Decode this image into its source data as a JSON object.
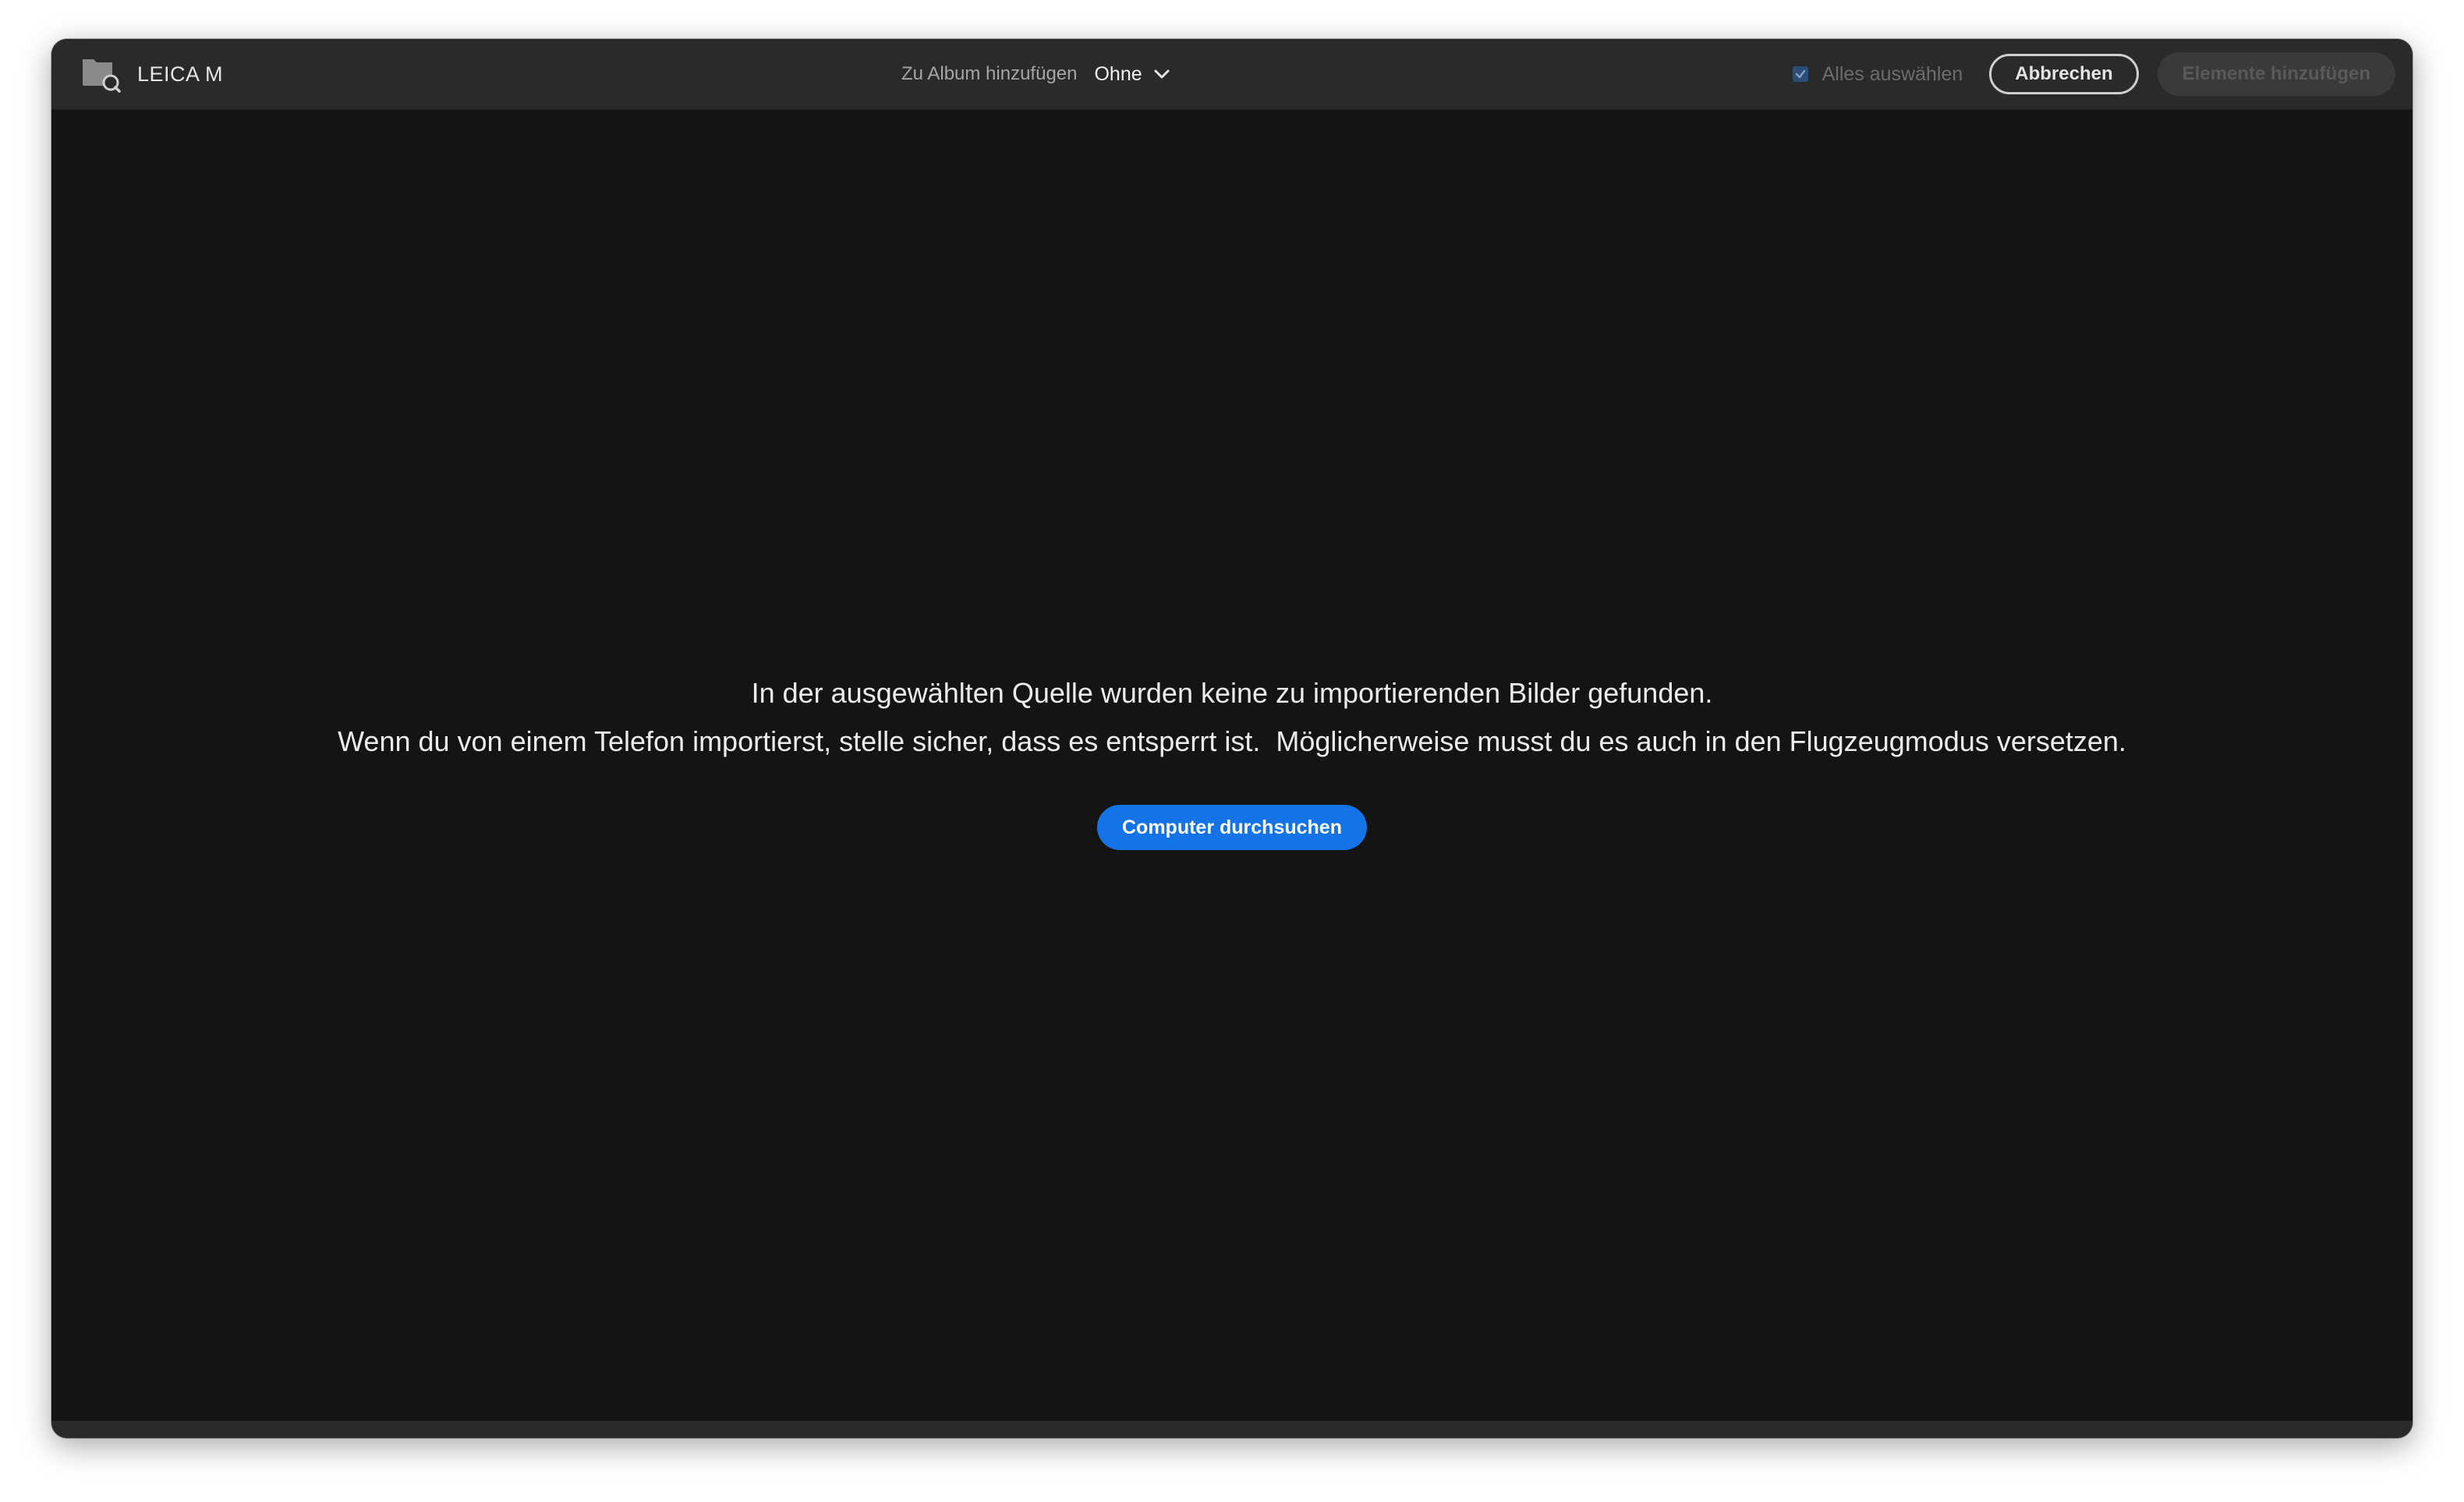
{
  "topbar": {
    "source_label": "LEICA M",
    "source_icon": "folder-search-icon",
    "album_label": "Zu Album hinzufügen",
    "album_value": "Ohne",
    "select_all_label": "Alles auswählen",
    "select_all_checked": true,
    "cancel_label": "Abbrechen",
    "add_label": "Elemente hinzufügen"
  },
  "empty_state": {
    "line1": "In der ausgewählten Quelle wurden keine zu importierenden Bilder gefunden.",
    "line2": "Wenn du von einem Telefon importierst, stelle sicher, dass es entsperrt ist.  Möglicherweise musst du es auch in den Flugzeugmodus versetzen.",
    "browse_label": "Computer durchsuchen"
  },
  "colors": {
    "accent": "#1473e6",
    "background": "#141414",
    "topbar": "#2a2a2a"
  }
}
